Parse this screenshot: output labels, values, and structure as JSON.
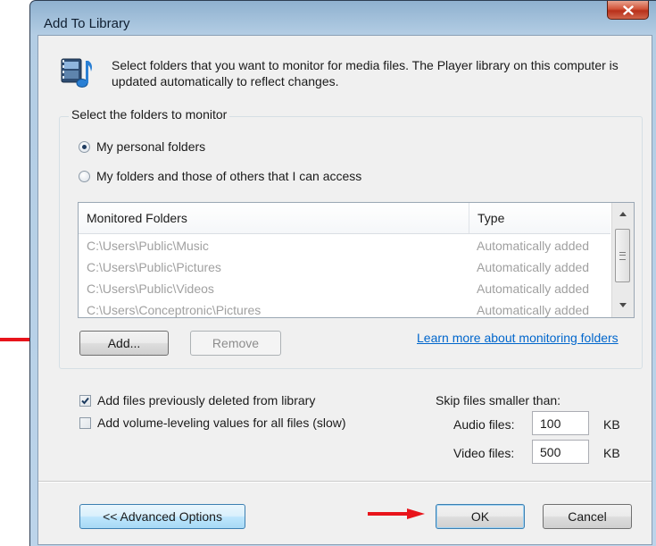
{
  "window": {
    "title": "Add To Library",
    "close_label": "x"
  },
  "header": {
    "icon": "media-library-icon",
    "description": "Select folders that you want to monitor for media files. The Player library on this computer is updated automatically to reflect changes."
  },
  "monitor_group": {
    "legend": "Select the folders to monitor",
    "options": [
      {
        "label": "My personal folders",
        "selected": true
      },
      {
        "label": "My folders and those of others that I can access",
        "selected": false
      }
    ]
  },
  "folder_list": {
    "columns": [
      "Monitored Folders",
      "Type"
    ],
    "rows": [
      {
        "folder": "C:\\Users\\Public\\Music",
        "type": "Automatically added"
      },
      {
        "folder": "C:\\Users\\Public\\Pictures",
        "type": "Automatically added"
      },
      {
        "folder": "C:\\Users\\Public\\Videos",
        "type": "Automatically added"
      },
      {
        "folder": "C:\\Users\\Conceptronic\\Pictures",
        "type": "Automatically added"
      }
    ]
  },
  "buttons": {
    "add": "Add...",
    "remove": "Remove",
    "advanced": "<< Advanced Options",
    "ok": "OK",
    "cancel": "Cancel"
  },
  "link": {
    "learn_more": "Learn more about monitoring folders"
  },
  "options": {
    "add_deleted": {
      "label": "Add files previously deleted from library",
      "checked": true
    },
    "volume_leveling": {
      "label": "Add volume-leveling values for all files (slow)",
      "checked": false
    }
  },
  "skip_files": {
    "label": "Skip files smaller than:",
    "audio": {
      "label": "Audio files:",
      "value": "100",
      "unit": "KB"
    },
    "video": {
      "label": "Video files:",
      "value": "500",
      "unit": "KB"
    }
  },
  "colors": {
    "annotation_arrow": "#e8141b",
    "link": "#0066cc",
    "frame": "#b3cde4"
  }
}
